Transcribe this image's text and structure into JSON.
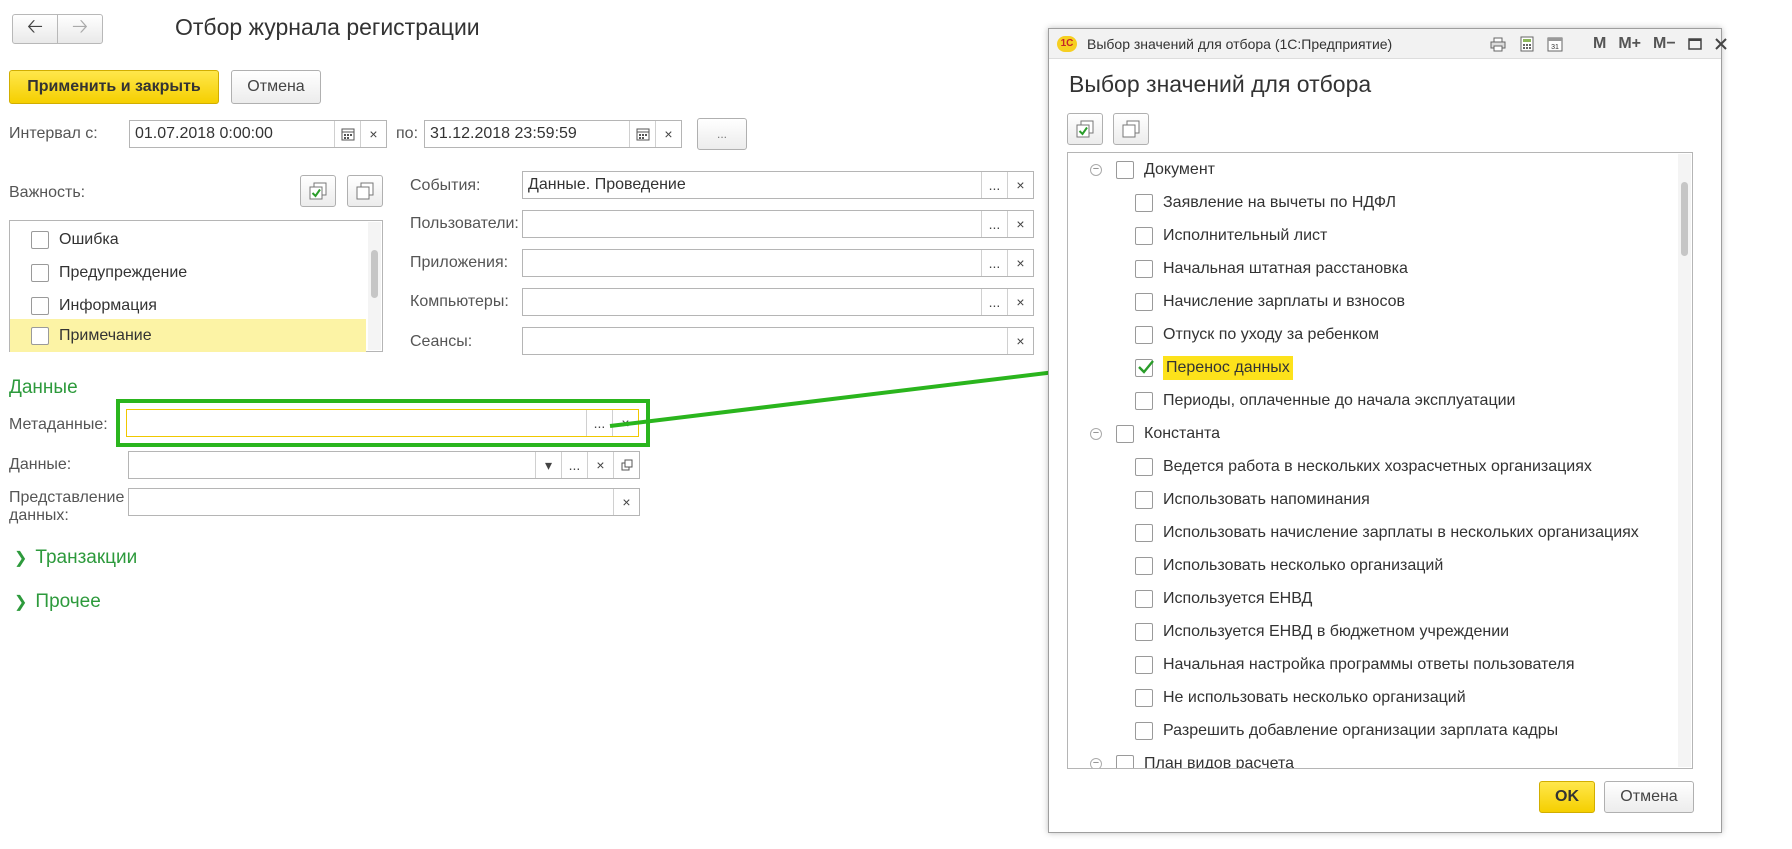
{
  "main": {
    "title": "Отбор журнала регистрации",
    "nav": {
      "back_icon": "arrow-left-icon",
      "forward_icon": "arrow-right-icon"
    },
    "toolbar": {
      "apply_label": "Применить и закрыть",
      "cancel_label": "Отмена"
    },
    "interval": {
      "from_label": "Интервал с:",
      "from_value": "01.07.2018  0:00:00",
      "to_label": "по:",
      "to_value": "31.12.2018 23:59:59",
      "extra_btn": "..."
    },
    "importance": {
      "label": "Важность:",
      "items": [
        {
          "label": "Ошибка",
          "checked": false
        },
        {
          "label": "Предупреждение",
          "checked": false
        },
        {
          "label": "Информация",
          "checked": false
        },
        {
          "label": "Примечание",
          "checked": false,
          "selected": true
        }
      ]
    },
    "filters": [
      {
        "label": "События:",
        "value": "Данные. Проведение"
      },
      {
        "label": "Пользователи:",
        "value": ""
      },
      {
        "label": "Приложения:",
        "value": ""
      },
      {
        "label": "Компьютеры:",
        "value": ""
      },
      {
        "label": "Сеансы:",
        "value": ""
      }
    ],
    "data_section": {
      "header": "Данные",
      "metadata_label": "Метаданные:",
      "metadata_value": "",
      "data_label": "Данные:",
      "data_value": "",
      "presentation_label_1": "Представление",
      "presentation_label_2": "данных:",
      "presentation_value": ""
    },
    "groups": [
      {
        "label": "Транзакции"
      },
      {
        "label": "Прочее"
      }
    ],
    "ellipsis": "...",
    "clear": "×",
    "dropdown": "▾"
  },
  "dialog": {
    "window_title": "Выбор значений для отбора  (1С:Предприятие)",
    "heading": "Выбор значений для отбора",
    "logo_text": "1С",
    "titlebar_buttons": [
      "M",
      "M+",
      "M−"
    ],
    "tree": [
      {
        "level": 0,
        "label": "Документ",
        "checked": false
      },
      {
        "level": 1,
        "label": "Заявление на вычеты по НДФЛ",
        "checked": false
      },
      {
        "level": 1,
        "label": "Исполнительный лист",
        "checked": false
      },
      {
        "level": 1,
        "label": "Начальная штатная расстановка",
        "checked": false
      },
      {
        "level": 1,
        "label": "Начисление зарплаты и взносов",
        "checked": false
      },
      {
        "level": 1,
        "label": "Отпуск по уходу за ребенком",
        "checked": false
      },
      {
        "level": 1,
        "label": "Перенос данных",
        "checked": true,
        "highlighted": true
      },
      {
        "level": 1,
        "label": "Периоды, оплаченные до начала эксплуатации",
        "checked": false
      },
      {
        "level": 0,
        "label": "Константа",
        "checked": false
      },
      {
        "level": 1,
        "label": "Ведется работа в нескольких хозрасчетных организациях",
        "checked": false
      },
      {
        "level": 1,
        "label": "Использовать напоминания",
        "checked": false
      },
      {
        "level": 1,
        "label": "Использовать начисление зарплаты в нескольких организациях",
        "checked": false
      },
      {
        "level": 1,
        "label": "Использовать несколько организаций",
        "checked": false
      },
      {
        "level": 1,
        "label": "Используется ЕНВД",
        "checked": false
      },
      {
        "level": 1,
        "label": "Используется ЕНВД в бюджетном учреждении",
        "checked": false
      },
      {
        "level": 1,
        "label": "Начальная настройка программы ответы пользователя",
        "checked": false
      },
      {
        "level": 1,
        "label": "Не использовать несколько организаций",
        "checked": false
      },
      {
        "level": 1,
        "label": "Разрешить добавление организации зарплата кадры",
        "checked": false
      },
      {
        "level": 0,
        "label": "План видов расчета",
        "checked": false
      }
    ],
    "ok_label": "OK",
    "cancel_label": "Отмена"
  },
  "colors": {
    "accent_yellow": "#f5cf00",
    "green": "#2ab51d",
    "section_green": "#2d9a3c",
    "highlight": "#fde21b"
  }
}
